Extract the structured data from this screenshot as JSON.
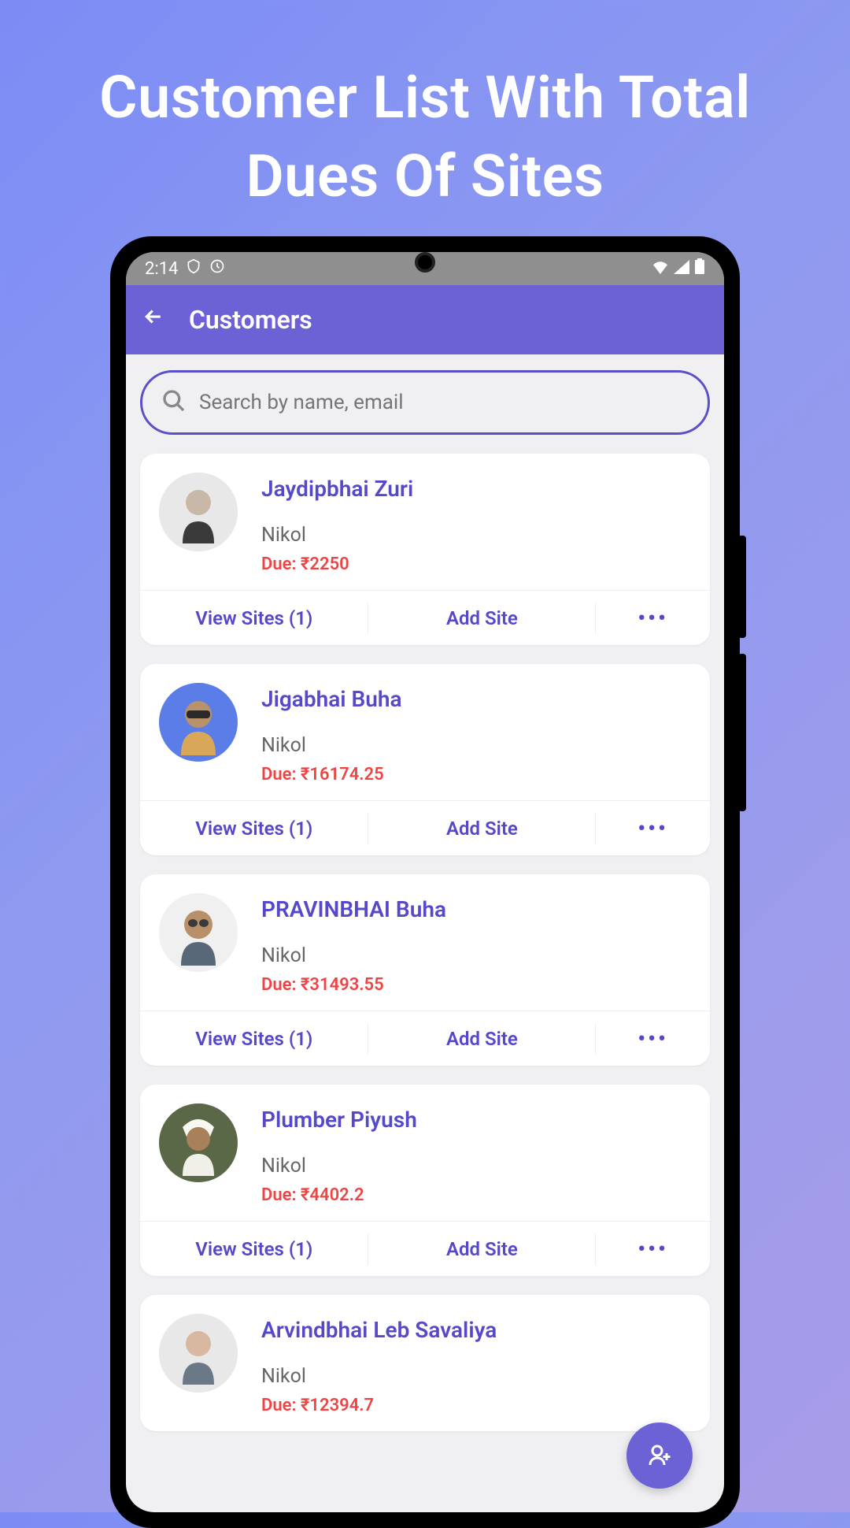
{
  "promo": {
    "title": "Customer List With Total Dues Of Sites"
  },
  "statusBar": {
    "time": "2:14"
  },
  "header": {
    "title": "Customers"
  },
  "search": {
    "placeholder": "Search by name, email"
  },
  "actions": {
    "viewSites": "View Sites (1)",
    "addSite": "Add Site"
  },
  "customers": [
    {
      "name": "Jaydipbhai Zuri",
      "location": "Nikol",
      "due": "Due: ₹2250"
    },
    {
      "name": "Jigabhai Buha",
      "location": "Nikol",
      "due": "Due: ₹16174.25"
    },
    {
      "name": "PRAVINBHAI Buha",
      "location": "Nikol",
      "due": "Due: ₹31493.55"
    },
    {
      "name": "Plumber Piyush",
      "location": "Nikol",
      "due": "Due: ₹4402.2"
    },
    {
      "name": "Arvindbhai Leb Savaliya",
      "location": "Nikol",
      "due": "Due: ₹12394.7"
    }
  ]
}
